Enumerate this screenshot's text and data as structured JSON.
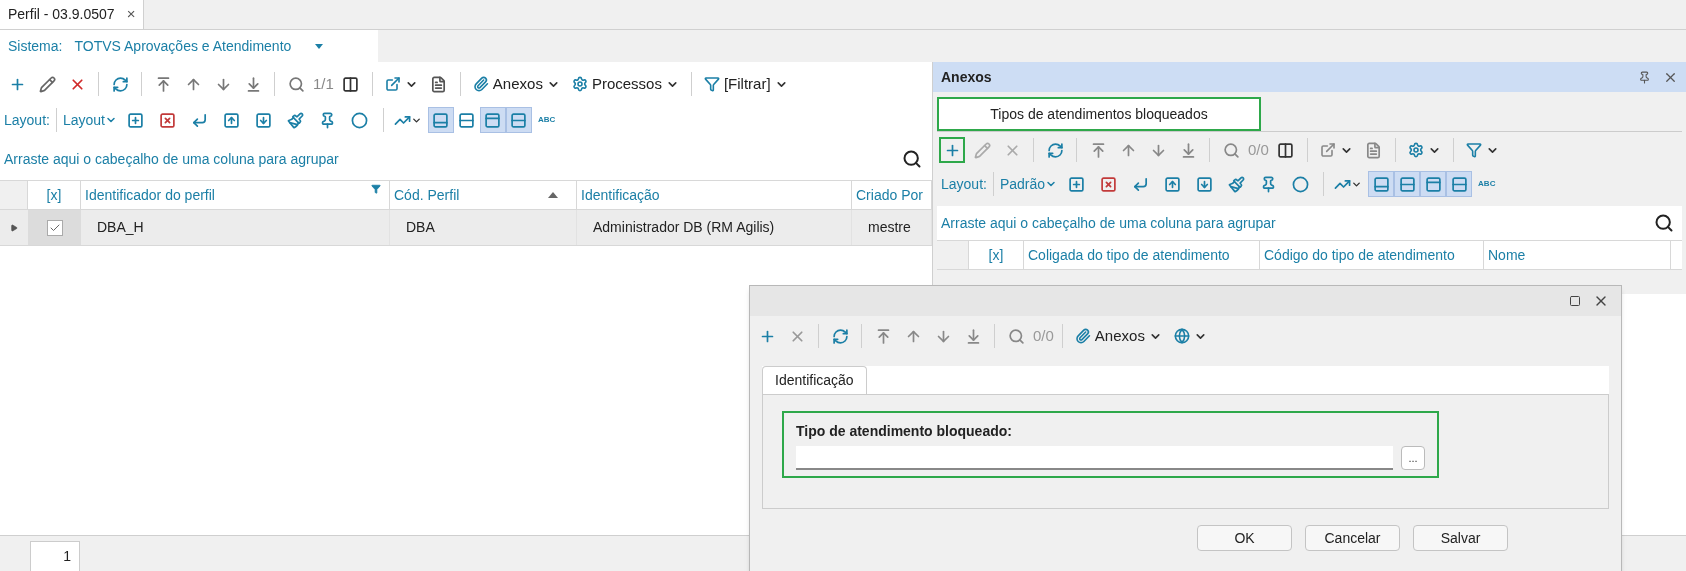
{
  "tab": {
    "title": "Perfil - 03.9.0507",
    "close": "×"
  },
  "system": {
    "label": "Sistema:",
    "value": "TOTVS Aprovações e Atendimento"
  },
  "toolbar": {
    "counter": "1/1",
    "attachments": "Anexos",
    "processes": "Processos",
    "filter": "[Filtrar]"
  },
  "layout_bar": {
    "label": "Layout:",
    "menu": "Layout",
    "views": [
      {
        "selected": true
      },
      {
        "selected": false
      },
      {
        "selected": true
      },
      {
        "selected": true
      }
    ],
    "spell": "ABC"
  },
  "group_hint": "Arraste aqui o cabeçalho de uma coluna para agrupar",
  "grid": {
    "check_column": "[x]",
    "columns": [
      {
        "label": "Identificador do perfil",
        "filtered": true
      },
      {
        "label": "Cód. Perfil",
        "sorted": true
      },
      {
        "label": "Identificação"
      },
      {
        "label": "Criado Por"
      }
    ],
    "rows": [
      {
        "selected": true,
        "checked": true,
        "cells": [
          "DBA_H",
          "DBA",
          "Administrador DB (RM Agilis)",
          "mestre"
        ]
      }
    ]
  },
  "pager": {
    "page": "1"
  },
  "attachments_panel": {
    "title": "Anexos",
    "tabs": [
      {
        "label": "Tipos de atendimentos bloqueados",
        "selected": true,
        "highlighted": true
      }
    ],
    "toolbar": {
      "add_highlighted": true,
      "counter": "0/0"
    },
    "layout_bar": {
      "label": "Layout:",
      "menu": "Padrão",
      "views": [
        {
          "selected": true
        },
        {
          "selected": true
        },
        {
          "selected": true
        },
        {
          "selected": true
        }
      ],
      "spell": "ABC"
    },
    "group_hint": "Arraste aqui o cabeçalho de uma coluna para agrupar",
    "columns": [
      "[x]",
      "Coligada do tipo de atendimento",
      "Código do tipo de atendimento",
      "Nome"
    ]
  },
  "dialog": {
    "toolbar": {
      "counter": "0/0",
      "attachments": "Anexos"
    },
    "tabs": [
      {
        "label": "Identificação",
        "selected": true
      }
    ],
    "field": {
      "label": "Tipo de atendimento bloqueado:",
      "highlighted": true,
      "browse": "..."
    },
    "buttons": [
      "OK",
      "Cancelar",
      "Salvar"
    ]
  }
}
